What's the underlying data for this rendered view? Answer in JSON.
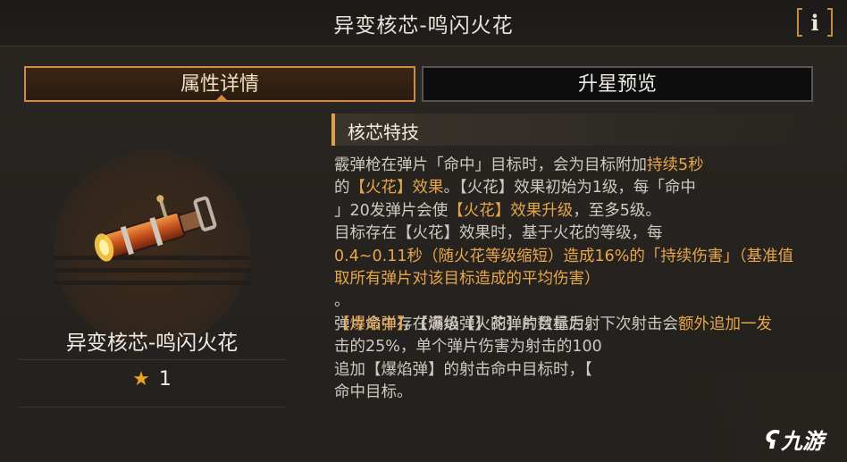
{
  "header": {
    "title": "异变核芯-鸣闪火花",
    "info_icon": "info-icon"
  },
  "tabs": [
    {
      "label": "属性详情",
      "active": true
    },
    {
      "label": "升星预览",
      "active": false
    }
  ],
  "item": {
    "name": "异变核芯-鸣闪火花",
    "star_count": "1",
    "star_icon": "star-icon"
  },
  "section": {
    "title": "核芯特技"
  },
  "description": {
    "p1": {
      "a": "霰弹枪在弹片「命中」目标时，会为目标附加",
      "b": "持续5秒",
      "c": "的",
      "d": "【火花】效果",
      "e": "。【火花】效果初始为1级，每「命中",
      "f": "」20发弹片会使",
      "g": "【火花】效果升级",
      "h": "，至多5级。"
    },
    "p2": {
      "a": "目标存在【火花】效果时，基于火花的等级，每",
      "b": "0.4~0.11秒（随火花等级缩短）造成16%的「持续伤害」（基准值取所有弹片对该目标造成的平均伤害）",
      "c": "。"
    },
    "p3": {
      "a": "弹片命中存在满级【火花】的目标后，下次射击会",
      "b": "额外追加一发",
      "c": "【爆焰弹】",
      "d": "。【爆焰弹】的弹片数量为射",
      "e": "击的25%，单个弹片伤害为射击的100",
      "f": "追加【爆焰弹】的射击命中目标时，【",
      "g": "命中目标。"
    }
  },
  "watermark": {
    "text": "九游",
    "icon": "jiuyou-logo-icon"
  },
  "colors": {
    "accent": "#d18a3e",
    "highlight": "#e8a64a",
    "star": "#e9a225"
  }
}
